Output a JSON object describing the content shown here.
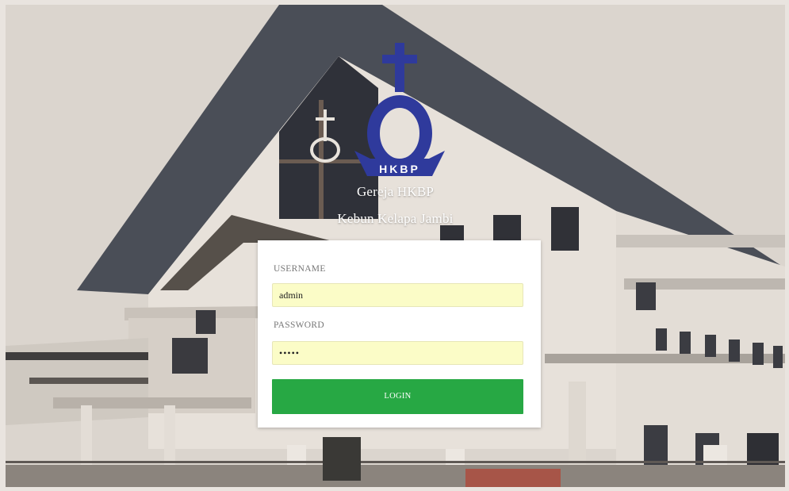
{
  "brand": {
    "logo_text": "HKBP",
    "line1": "Gereja HKBP",
    "line2": "Kebun Kelapa Jambi"
  },
  "form": {
    "username_label": "USERNAME",
    "username_value": "admin",
    "password_label": "PASSWORD",
    "password_masked": "•••••",
    "login_label": "LOGIN"
  },
  "colors": {
    "login_button": "#27a844",
    "input_bg": "#fbfcc7",
    "logo_blue": "#2f3a9c"
  }
}
